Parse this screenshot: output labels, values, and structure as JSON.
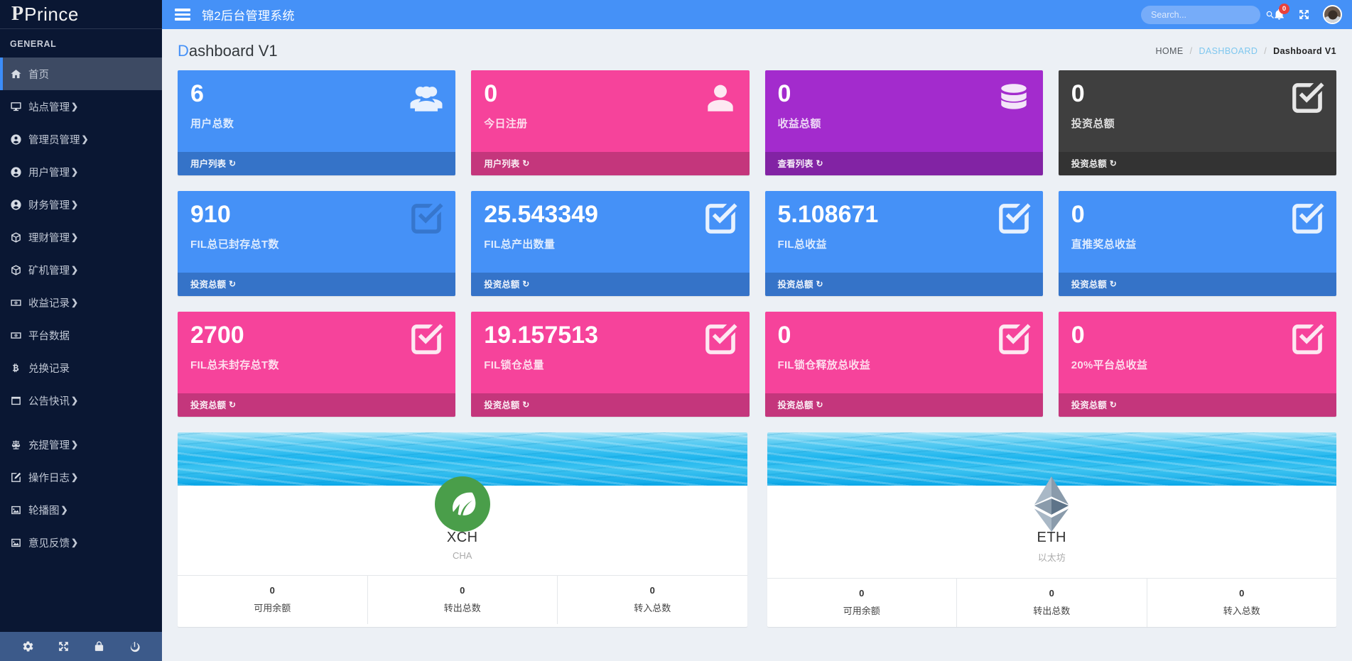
{
  "brand": {
    "logo_letter": "P",
    "name": "Prince"
  },
  "sidebar": {
    "section_header": "GENERAL",
    "items": [
      {
        "label": "首页",
        "icon": "home-icon",
        "arrow": "",
        "active": true
      },
      {
        "label": "站点管理",
        "icon": "monitor-icon",
        "arrow": "❯",
        "active": false
      },
      {
        "label": "管理员管理",
        "icon": "user-circle-icon",
        "arrow": "❯",
        "active": false
      },
      {
        "label": "用户管理",
        "icon": "user-circle-icon",
        "arrow": "❯",
        "active": false
      },
      {
        "label": "财务管理",
        "icon": "user-circle-icon",
        "arrow": "❯",
        "active": false
      },
      {
        "label": "理财管理",
        "icon": "cube-icon",
        "arrow": "❯",
        "active": false
      },
      {
        "label": "矿机管理",
        "icon": "cube-icon",
        "arrow": "❯",
        "active": false
      },
      {
        "label": "收益记录",
        "icon": "money-icon",
        "arrow": "❯",
        "active": false
      },
      {
        "label": "平台数据",
        "icon": "money-icon",
        "arrow": "",
        "active": false
      },
      {
        "label": "兑换记录",
        "icon": "bitcoin-icon",
        "arrow": "",
        "active": false
      },
      {
        "label": "公告快讯",
        "icon": "window-icon",
        "arrow": "❯",
        "active": false
      },
      {
        "label": "充提管理",
        "icon": "balance-icon",
        "arrow": "❯",
        "active": false
      },
      {
        "label": "操作日志",
        "icon": "edit-icon",
        "arrow": "❯",
        "active": false
      },
      {
        "label": "轮播图",
        "icon": "image-icon",
        "arrow": "❯",
        "active": false
      },
      {
        "label": "意见反馈",
        "icon": "image-icon",
        "arrow": "❯",
        "active": false
      }
    ],
    "footer_icons": [
      "gear-icon",
      "expand-icon",
      "lock-icon",
      "power-icon"
    ]
  },
  "topbar": {
    "menu_toggle": "hamburger-icon",
    "app_title": "锦2后台管理系统",
    "search": {
      "value": "",
      "placeholder": "Search...",
      "icon": "search-icon"
    },
    "notifications": {
      "icon": "bell-icon",
      "count": "0"
    },
    "fullscreen_icon": "expand-icon",
    "avatar": "user-avatar"
  },
  "page": {
    "title_highlight": "D",
    "title_rest": "ashboard V1",
    "breadcrumb": [
      {
        "label": "HOME",
        "type": "plain"
      },
      {
        "label": "DASHBOARD",
        "type": "link"
      },
      {
        "label": "Dashboard V1",
        "type": "current"
      }
    ],
    "breadcrumb_sep": "/"
  },
  "stat_cards": [
    {
      "value": "6",
      "label": "用户总数",
      "footer": "用户列表",
      "theme": "c-blue",
      "icon": "users-icon",
      "dim_icon": false
    },
    {
      "value": "0",
      "label": "今日注册",
      "footer": "用户列表",
      "theme": "c-pink",
      "icon": "user-icon",
      "dim_icon": false
    },
    {
      "value": "0",
      "label": "收益总额",
      "footer": "查看列表",
      "theme": "c-purple",
      "icon": "database-icon",
      "dim_icon": false
    },
    {
      "value": "0",
      "label": "投资总额",
      "footer": "投资总额",
      "theme": "c-dark",
      "icon": "checkbox-icon",
      "dim_icon": false
    },
    {
      "value": "910",
      "label": "FIL总已封存总T数",
      "footer": "投资总额",
      "theme": "c-blue",
      "icon": "checkbox-icon",
      "dim_icon": true
    },
    {
      "value": "25.543349",
      "label": "FIL总产出数量",
      "footer": "投资总额",
      "theme": "c-blue",
      "icon": "checkbox-icon",
      "dim_icon": false
    },
    {
      "value": "5.108671",
      "label": "FIL总收益",
      "footer": "投资总额",
      "theme": "c-blue",
      "icon": "checkbox-icon",
      "dim_icon": false
    },
    {
      "value": "0",
      "label": "直推奖总收益",
      "footer": "投资总额",
      "theme": "c-blue",
      "icon": "checkbox-icon",
      "dim_icon": false
    },
    {
      "value": "2700",
      "label": "FIL总未封存总T数",
      "footer": "投资总额",
      "theme": "c-pink",
      "icon": "checkbox-icon",
      "dim_icon": false
    },
    {
      "value": "19.157513",
      "label": "FIL锁仓总量",
      "footer": "投资总额",
      "theme": "c-pink",
      "icon": "checkbox-icon",
      "dim_icon": false
    },
    {
      "value": "0",
      "label": "FIL锁仓释放总收益",
      "footer": "投资总额",
      "theme": "c-pink",
      "icon": "checkbox-icon",
      "dim_icon": false
    },
    {
      "value": "0",
      "label": "20%平台总收益",
      "footer": "投资总额",
      "theme": "c-pink",
      "icon": "checkbox-icon",
      "dim_icon": false
    }
  ],
  "coin_cards": [
    {
      "symbol": "XCH",
      "name": "CHA",
      "logo": "chia-leaf-icon",
      "stats": [
        {
          "value": "0",
          "label": "可用余额"
        },
        {
          "value": "0",
          "label": "转出总数"
        },
        {
          "value": "0",
          "label": "转入总数"
        }
      ]
    },
    {
      "symbol": "ETH",
      "name": "以太坊",
      "logo": "ethereum-icon",
      "stats": [
        {
          "value": "0",
          "label": "可用余额"
        },
        {
          "value": "0",
          "label": "转出总数"
        },
        {
          "value": "0",
          "label": "转入总数"
        }
      ]
    }
  ],
  "colors": {
    "sidebar_bg": "#0a1733",
    "sidebar_active": "#3d4a63",
    "accent_blue": "#4591f7",
    "pink": "#f6439b",
    "purple": "#a32bcd",
    "dark": "#3f3f3f",
    "page_bg": "#ecf0f5",
    "badge_red": "#e9413c"
  }
}
